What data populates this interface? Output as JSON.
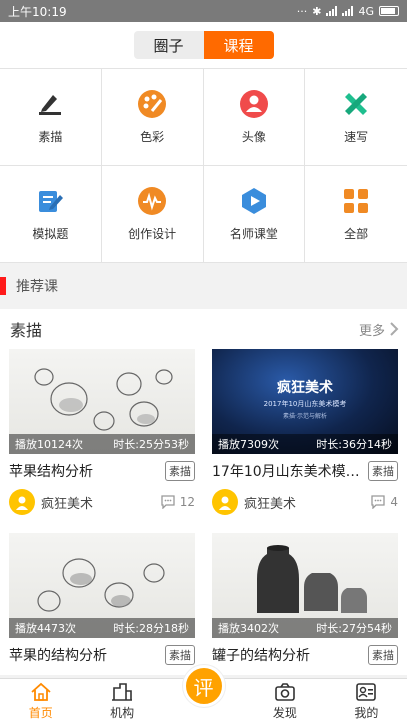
{
  "status_bar": {
    "time": "上午10:19",
    "network": "4G"
  },
  "segment": {
    "left": "圈子",
    "right": "课程",
    "active": "right"
  },
  "categories": [
    {
      "label": "素描",
      "icon": "sketch-pencil-icon",
      "color": "#333333"
    },
    {
      "label": "色彩",
      "icon": "palette-icon",
      "color": "#f08a24"
    },
    {
      "label": "头像",
      "icon": "portrait-icon",
      "color": "#f04b4b"
    },
    {
      "label": "速写",
      "icon": "ruler-pencil-icon",
      "color": "#1fbf8f"
    },
    {
      "label": "模拟题",
      "icon": "edit-document-icon",
      "color": "#3a8ddc"
    },
    {
      "label": "创作设计",
      "icon": "waveform-icon",
      "color": "#f08a24"
    },
    {
      "label": "名师课堂",
      "icon": "video-play-icon",
      "color": "#3a8ddc"
    },
    {
      "label": "全部",
      "icon": "grid-all-icon",
      "color": "#f08a24"
    }
  ],
  "recommended_header": "推荐课",
  "section": {
    "title": "素描",
    "more": "更多",
    "cards": [
      {
        "plays": "播放10124次",
        "duration": "时长:25分53秒",
        "title": "苹果结构分析",
        "tag": "素描",
        "author": "疯狂美术",
        "comments": "12"
      },
      {
        "plays": "播放7309次",
        "duration": "时长:36分14秒",
        "title": "17年10月山东美术模…",
        "tag": "素描",
        "author": "疯狂美术",
        "comments": "4",
        "banner_title": "疯狂美术",
        "banner_sub": "2017年10月山东美术模考",
        "banner_tag": "素描·示范与解析"
      },
      {
        "plays": "播放4473次",
        "duration": "时长:28分18秒",
        "title": "苹果的结构分析",
        "tag": "素描"
      },
      {
        "plays": "播放3402次",
        "duration": "时长:27分54秒",
        "title": "罐子的结构分析",
        "tag": "素描"
      }
    ]
  },
  "tabbar": {
    "items": [
      {
        "label": "首页",
        "icon": "home-icon"
      },
      {
        "label": "机构",
        "icon": "building-icon"
      },
      {
        "label": "评",
        "icon": "review-fab-icon"
      },
      {
        "label": "发现",
        "icon": "discover-camera-icon"
      },
      {
        "label": "我的",
        "icon": "profile-card-icon"
      }
    ],
    "active": "首页"
  },
  "colors": {
    "accent": "#ff6a00",
    "tab_active": "#ff8a00",
    "recommend_bar": "#ff1a1a",
    "avatar": "#ffc400"
  }
}
